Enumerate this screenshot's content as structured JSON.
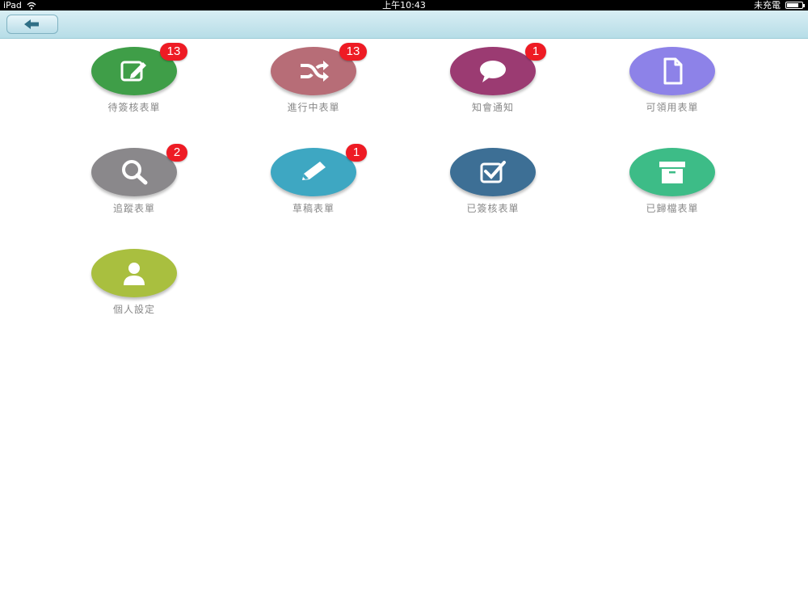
{
  "status_bar": {
    "device": "iPad",
    "time": "上午10:43",
    "charging": "未充電"
  },
  "nav": {
    "back_icon": "back-arrow-icon"
  },
  "tiles": [
    {
      "label": "待簽核表單",
      "badge": "13",
      "icon": "edit-note-icon",
      "color": "#3f9e48"
    },
    {
      "label": "進行中表單",
      "badge": "13",
      "icon": "shuffle-icon",
      "color": "#b76d77"
    },
    {
      "label": "知會通知",
      "badge": "1",
      "icon": "chat-bubble-icon",
      "color": "#9b3b72"
    },
    {
      "label": "可領用表單",
      "badge": "",
      "icon": "document-icon",
      "color": "#8d82e8"
    },
    {
      "label": "追蹤表單",
      "badge": "2",
      "icon": "magnifier-icon",
      "color": "#8a888b"
    },
    {
      "label": "草稿表單",
      "badge": "1",
      "icon": "pencil-icon",
      "color": "#3ea7c2"
    },
    {
      "label": "已簽核表單",
      "badge": "",
      "icon": "checkbox-icon",
      "color": "#3d6f95"
    },
    {
      "label": "已歸檔表單",
      "badge": "",
      "icon": "archive-box-icon",
      "color": "#3dbc87"
    },
    {
      "label": "個人設定",
      "badge": "",
      "icon": "user-icon",
      "color": "#a9bf3f"
    }
  ]
}
